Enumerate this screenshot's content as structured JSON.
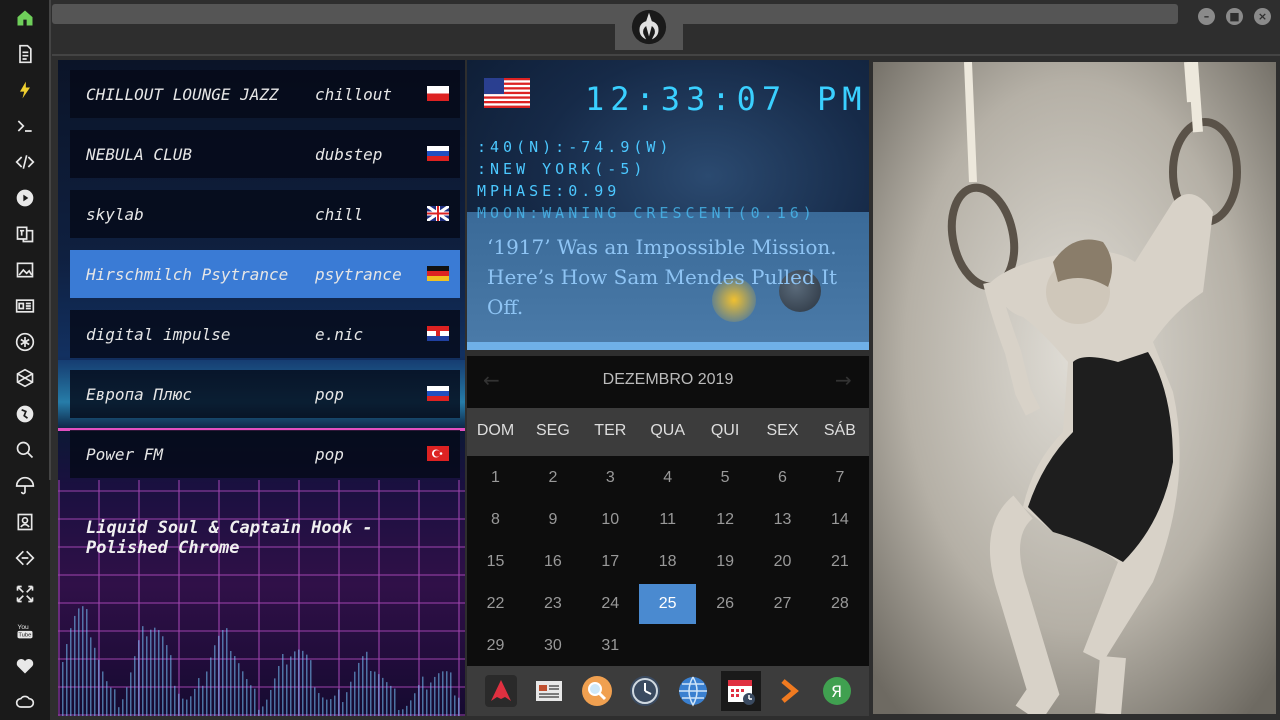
{
  "rail": [
    {
      "icon": "home-icon"
    },
    {
      "icon": "document-icon"
    },
    {
      "icon": "lightning-icon"
    },
    {
      "icon": "terminal-icon"
    },
    {
      "icon": "code-icon"
    },
    {
      "icon": "play-icon"
    },
    {
      "icon": "translate-icon"
    },
    {
      "icon": "image-icon"
    },
    {
      "icon": "news-icon"
    },
    {
      "icon": "asterisk-icon"
    },
    {
      "icon": "hexagon-icon"
    },
    {
      "icon": "globe-icon"
    },
    {
      "icon": "search-icon"
    },
    {
      "icon": "umbrella-icon"
    },
    {
      "icon": "contact-icon"
    },
    {
      "icon": "link-icon"
    },
    {
      "icon": "expand-icon"
    },
    {
      "icon": "youtube-icon"
    },
    {
      "icon": "heart-icon"
    },
    {
      "icon": "cloud-icon"
    }
  ],
  "window": {
    "minimize": "–",
    "maximize": "■",
    "close": "×"
  },
  "stations": [
    {
      "name": "CHILLOUT LOUNGE JAZZ",
      "genre": "chillout",
      "flag": "poland"
    },
    {
      "name": "NEBULA CLUB",
      "genre": "dubstep",
      "flag": "russia"
    },
    {
      "name": "skylab",
      "genre": "chill",
      "flag": "uk"
    },
    {
      "name": "Hirschmilch Psytrance",
      "genre": "psytrance",
      "flag": "germany"
    },
    {
      "name": "digital impulse",
      "genre": "e.nic",
      "flag": "croatia"
    },
    {
      "name": "Европа Плюс",
      "genre": "pop",
      "flag": "russia"
    },
    {
      "name": "Power FM",
      "genre": "pop",
      "flag": "turkey"
    }
  ],
  "now_playing": "Liquid Soul & Captain Hook - Polished Chrome",
  "clock": {
    "time": "12:33:07",
    "ampm": "PM",
    "coords": ":40(N):-74.9(W)",
    "city": ":NEW YORK(-5)",
    "mphase": "MPHASE:0.99",
    "moon": "MOON:WANING CRESCENT(0.16)",
    "headline": "‘1917’ Was an Impossible Mission. Here’s How Sam Mendes Pulled It Off."
  },
  "calendar": {
    "title": "DEZEMBRO 2019",
    "prev": "←",
    "next": "→",
    "weekdays": [
      "DOM",
      "SEG",
      "TER",
      "QUA",
      "QUI",
      "SEX",
      "SÁB"
    ],
    "today": "25",
    "days": [
      "1",
      "2",
      "3",
      "4",
      "5",
      "6",
      "7",
      "8",
      "9",
      "10",
      "11",
      "12",
      "13",
      "14",
      "15",
      "16",
      "17",
      "18",
      "19",
      "20",
      "21",
      "22",
      "23",
      "24",
      "25",
      "26",
      "27",
      "28",
      "29",
      "30",
      "31"
    ]
  },
  "dock": [
    {
      "icon": "arch-icon"
    },
    {
      "icon": "news-reader-icon"
    },
    {
      "icon": "search-app-icon"
    },
    {
      "icon": "clock-app-icon"
    },
    {
      "icon": "browser-globe-icon"
    },
    {
      "icon": "calendar-app-icon"
    },
    {
      "icon": "forward-arrow-icon"
    },
    {
      "icon": "yandex-icon"
    }
  ],
  "colors": {
    "accent": "#3a7bd5",
    "digital": "#3ad0ff",
    "today": "#4a8ad0",
    "rail_active": "#6fcf5a"
  }
}
